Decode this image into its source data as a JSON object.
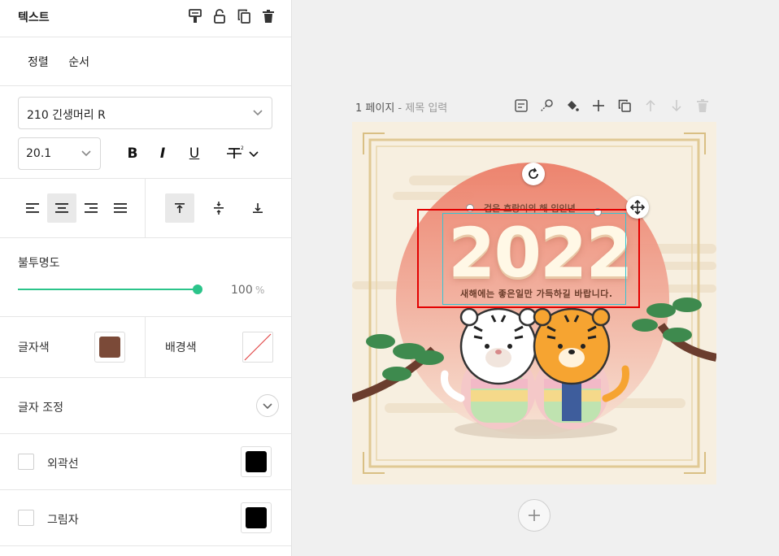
{
  "panel": {
    "title": "텍스트",
    "tabs": [
      "정렬",
      "순서"
    ],
    "font_family": "210 긴생머리 R",
    "font_size": "20.1",
    "format": {
      "bold": "B",
      "italic": "I",
      "underline": "U"
    },
    "opacity_label": "불투명도",
    "opacity_value": "100",
    "opacity_unit": "%",
    "opacity_level": 1.0,
    "text_color_label": "글자색",
    "text_color": "#7b4a38",
    "bg_color_label": "배경색",
    "adjust_label": "글자 조정",
    "outline_label": "외곽선",
    "outline_color": "#000000",
    "shadow_label": "그림자",
    "shadow_color": "#000000",
    "align_active": "center",
    "valign_active": "top"
  },
  "page": {
    "number_label": "1 페이지",
    "separator": " - ",
    "title_placeholder": "제목 입력"
  },
  "canvas_text": {
    "year": "2022",
    "top_line": "검은 호랑이의 해 임인년",
    "bottom_line": "새해에는 좋은일만 가득하길 바랍니다."
  },
  "colors": {
    "accent": "#2bc48a",
    "selection": "#35c4d4",
    "highlight": "#e30000"
  }
}
